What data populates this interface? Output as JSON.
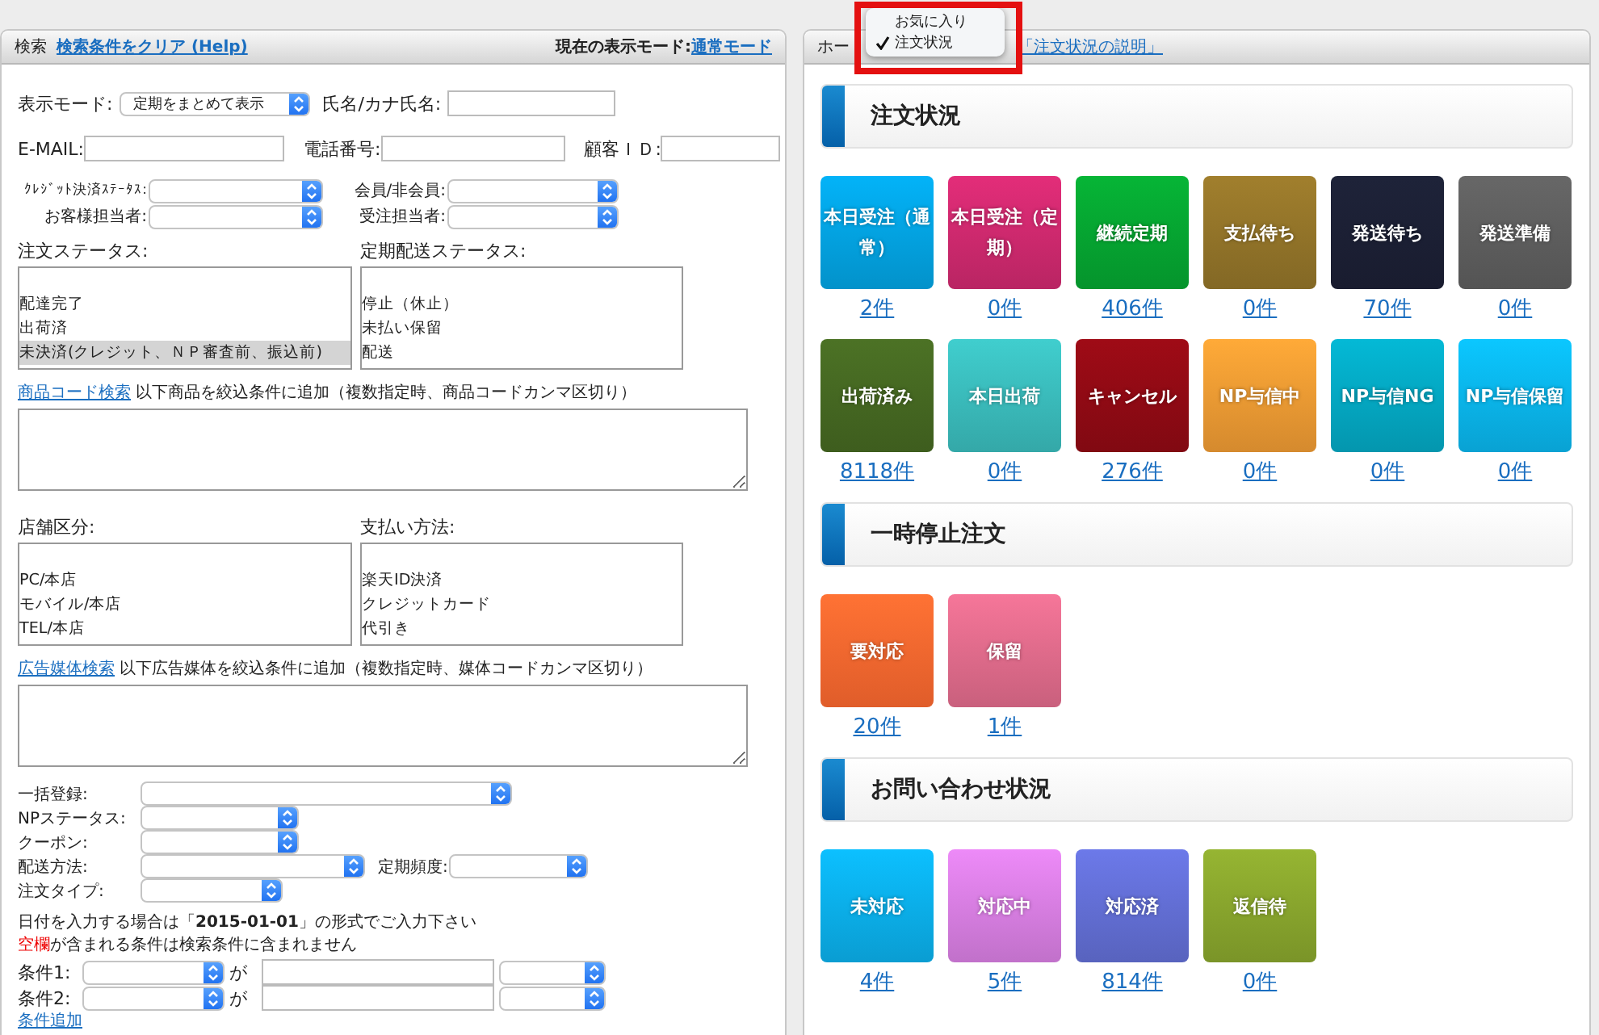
{
  "search_panel": {
    "title": "検索",
    "clear_link": "検索条件をクリア (Help)",
    "mode_label": "現在の表示モード:",
    "mode_link": "通常モード",
    "display_mode": {
      "label": "表示モード:",
      "value": "定期をまとめて表示"
    },
    "name_field": {
      "label": "氏名/カナ氏名:"
    },
    "contact_fields": [
      {
        "label": "E-MAIL:"
      },
      {
        "label": "電話番号:"
      },
      {
        "label": "顧客ＩＤ:"
      }
    ],
    "status_selects": [
      {
        "label": "ｸﾚｼﾞｯﾄ決済ｽﾃｰﾀｽ:"
      },
      {
        "label": "会員/非会員:"
      },
      {
        "label": "お客様担当者:"
      },
      {
        "label": "受注担当者:"
      }
    ],
    "status_lists": [
      {
        "label": "注文ステータス:",
        "options": [
          {
            "text": "配達完了",
            "selected": false
          },
          {
            "text": "出荷済",
            "selected": false
          },
          {
            "text": "未決済(クレジット、ＮＰ審査前、振込前)",
            "selected": true
          }
        ]
      },
      {
        "label": "定期配送ステータス:",
        "options": [
          {
            "text": "停止（休止）",
            "selected": false
          },
          {
            "text": "未払い保留",
            "selected": false
          },
          {
            "text": "配送",
            "selected": false
          }
        ]
      }
    ],
    "product_search": {
      "link": "商品コード検索",
      "note": "以下商品を絞込条件に追加（複数指定時、商品コードカンマ区切り）"
    },
    "shop_lists": [
      {
        "label": "店舗区分:",
        "options": [
          {
            "text": "PC/本店",
            "selected": false
          },
          {
            "text": "モバイル/本店",
            "selected": false
          },
          {
            "text": "TEL/本店",
            "selected": false
          }
        ]
      },
      {
        "label": "支払い方法:",
        "options": [
          {
            "text": "楽天ID決済",
            "selected": false
          },
          {
            "text": "クレジットカード",
            "selected": false
          },
          {
            "text": "代引き",
            "selected": false
          }
        ]
      }
    ],
    "media_search": {
      "link": "広告媒体検索",
      "note": "以下広告媒体を絞込条件に追加（複数指定時、媒体コードカンマ区切り）"
    },
    "option_selects": [
      {
        "label": "一括登録:"
      },
      {
        "label": "NPステータス:"
      },
      {
        "label": "クーポン:"
      },
      {
        "label": "配送方法:",
        "extra_label": "定期頻度:"
      },
      {
        "label": "注文タイプ:"
      }
    ],
    "date_note": "日付を入力する場合は「**2015-01-01**」の形式でご入力下さい",
    "blank_note": {
      "warning": "空欄",
      "text": "が含まれる条件は検索条件に含まれません"
    },
    "conditions": [
      {
        "label": "条件1:",
        "joiner": "が"
      },
      {
        "label": "条件2:",
        "joiner": "が"
      }
    ],
    "add_condition_link": "条件追加"
  },
  "status_panel": {
    "title": "ホー",
    "help_link": "「注文状況の説明」",
    "menu": [
      {
        "label": "お気に入り",
        "checked": false
      },
      {
        "label": "注文状況",
        "checked": true
      }
    ],
    "sections": [
      {
        "title": "注文状況",
        "tiles": [
          {
            "label": "本日受注（通常）",
            "count": "2件",
            "color": "#03a6e6"
          },
          {
            "label": "本日受注（定期）",
            "count": "0件",
            "color": "#d22a70"
          },
          {
            "label": "継続定期",
            "count": "406件",
            "color": "#06a832"
          },
          {
            "label": "支払待ち",
            "count": "0件",
            "color": "#95762a"
          },
          {
            "label": "発送待ち",
            "count": "70件",
            "color": "#1c2035"
          },
          {
            "label": "発送準備",
            "count": "0件",
            "color": "#5f5f5f"
          },
          {
            "label": "出荷済み",
            "count": "8118件",
            "color": "#466a22"
          },
          {
            "label": "本日出荷",
            "count": "0件",
            "color": "#3bbfbf"
          },
          {
            "label": "キャンセル",
            "count": "276件",
            "color": "#930a14"
          },
          {
            "label": "NP与信中",
            "count": "0件",
            "color": "#f29d34"
          },
          {
            "label": "NP与信NG",
            "count": "0件",
            "color": "#04abc6"
          },
          {
            "label": "NP与信保留",
            "count": "0件",
            "color": "#0ab8f0"
          }
        ]
      },
      {
        "title": "一時停止注文",
        "tiles": [
          {
            "label": "要対応",
            "count": "20件",
            "color": "#ff6a30"
          },
          {
            "label": "保留",
            "count": "1件",
            "color": "#e46d8e"
          }
        ]
      },
      {
        "title": "お問い合わせ状況",
        "tiles": [
          {
            "label": "未対応",
            "count": "4件",
            "color": "#0bb2ef"
          },
          {
            "label": "対応中",
            "count": "5件",
            "color": "#db80e6"
          },
          {
            "label": "対応済",
            "count": "814件",
            "color": "#6470d8"
          },
          {
            "label": "返信待",
            "count": "0件",
            "color": "#8ba82e"
          }
        ]
      }
    ]
  }
}
